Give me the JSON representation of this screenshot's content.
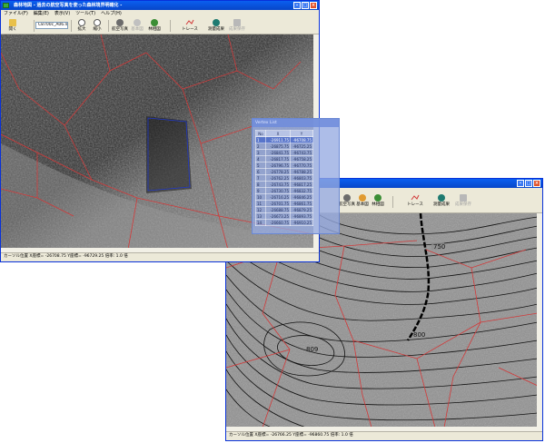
{
  "window1": {
    "title": "森林地図 - 過去の航空写真を使った森林境界明確化 -",
    "menu": [
      "ファイル(F)",
      "編集(E)",
      "表示(V)",
      "ツール(T)",
      "ヘルプ(H)"
    ],
    "toolbar": {
      "open": "開く",
      "file_combo": "C8700c_A06.lnd",
      "zoom_in": "拡大",
      "zoom_out": "縮小",
      "aerial": "航空写真",
      "base_map": "基本図",
      "forest_map": "林相図",
      "trace": "トレース",
      "survey": "測量成果",
      "result_save": "成果保存"
    },
    "status": "カーソル位置 X座標= -26708.75  Y座標= -96729.25  倍率: 1.0 倍"
  },
  "window2": {
    "toolbar": {
      "aerial": "航空写真",
      "base_map": "基本図",
      "forest_map": "林相図",
      "trace": "トレース",
      "survey": "測量成果",
      "result_save": "成果保存"
    },
    "status": "カーソル位置 X座標= -26766.25  Y座標= -96860.75  倍率: 1.0 倍",
    "contour_labels": [
      "750",
      "800",
      "809"
    ]
  },
  "coord_panel": {
    "title": "Vertex List",
    "headers": [
      "No",
      "X",
      "Y"
    ],
    "rows": [
      {
        "no": "1",
        "x": "-26911.75",
        "y": "-96708.75"
      },
      {
        "no": "2",
        "x": "-26875.75",
        "y": "-96725.25"
      },
      {
        "no": "3",
        "x": "-26841.75",
        "y": "-96743.75"
      },
      {
        "no": "4",
        "x": "-26817.75",
        "y": "-96758.25"
      },
      {
        "no": "5",
        "x": "-26796.75",
        "y": "-96770.75"
      },
      {
        "no": "6",
        "x": "-26778.25",
        "y": "-96788.25"
      },
      {
        "no": "7",
        "x": "-26762.25",
        "y": "-96803.75"
      },
      {
        "no": "8",
        "x": "-26743.75",
        "y": "-96817.25"
      },
      {
        "no": "9",
        "x": "-26730.75",
        "y": "-96832.75"
      },
      {
        "no": "10",
        "x": "-26716.25",
        "y": "-96846.25"
      },
      {
        "no": "11",
        "x": "-26701.75",
        "y": "-96861.75"
      },
      {
        "no": "12",
        "x": "-26688.75",
        "y": "-96879.25"
      },
      {
        "no": "13",
        "x": "-26673.25",
        "y": "-96893.75"
      },
      {
        "no": "14",
        "x": "-26660.75",
        "y": "-96910.25"
      }
    ]
  },
  "colors": {
    "titlebar": "#0846c8",
    "boundary": "#d23a3a",
    "contour": "#111111",
    "panel": "#96aae1"
  }
}
